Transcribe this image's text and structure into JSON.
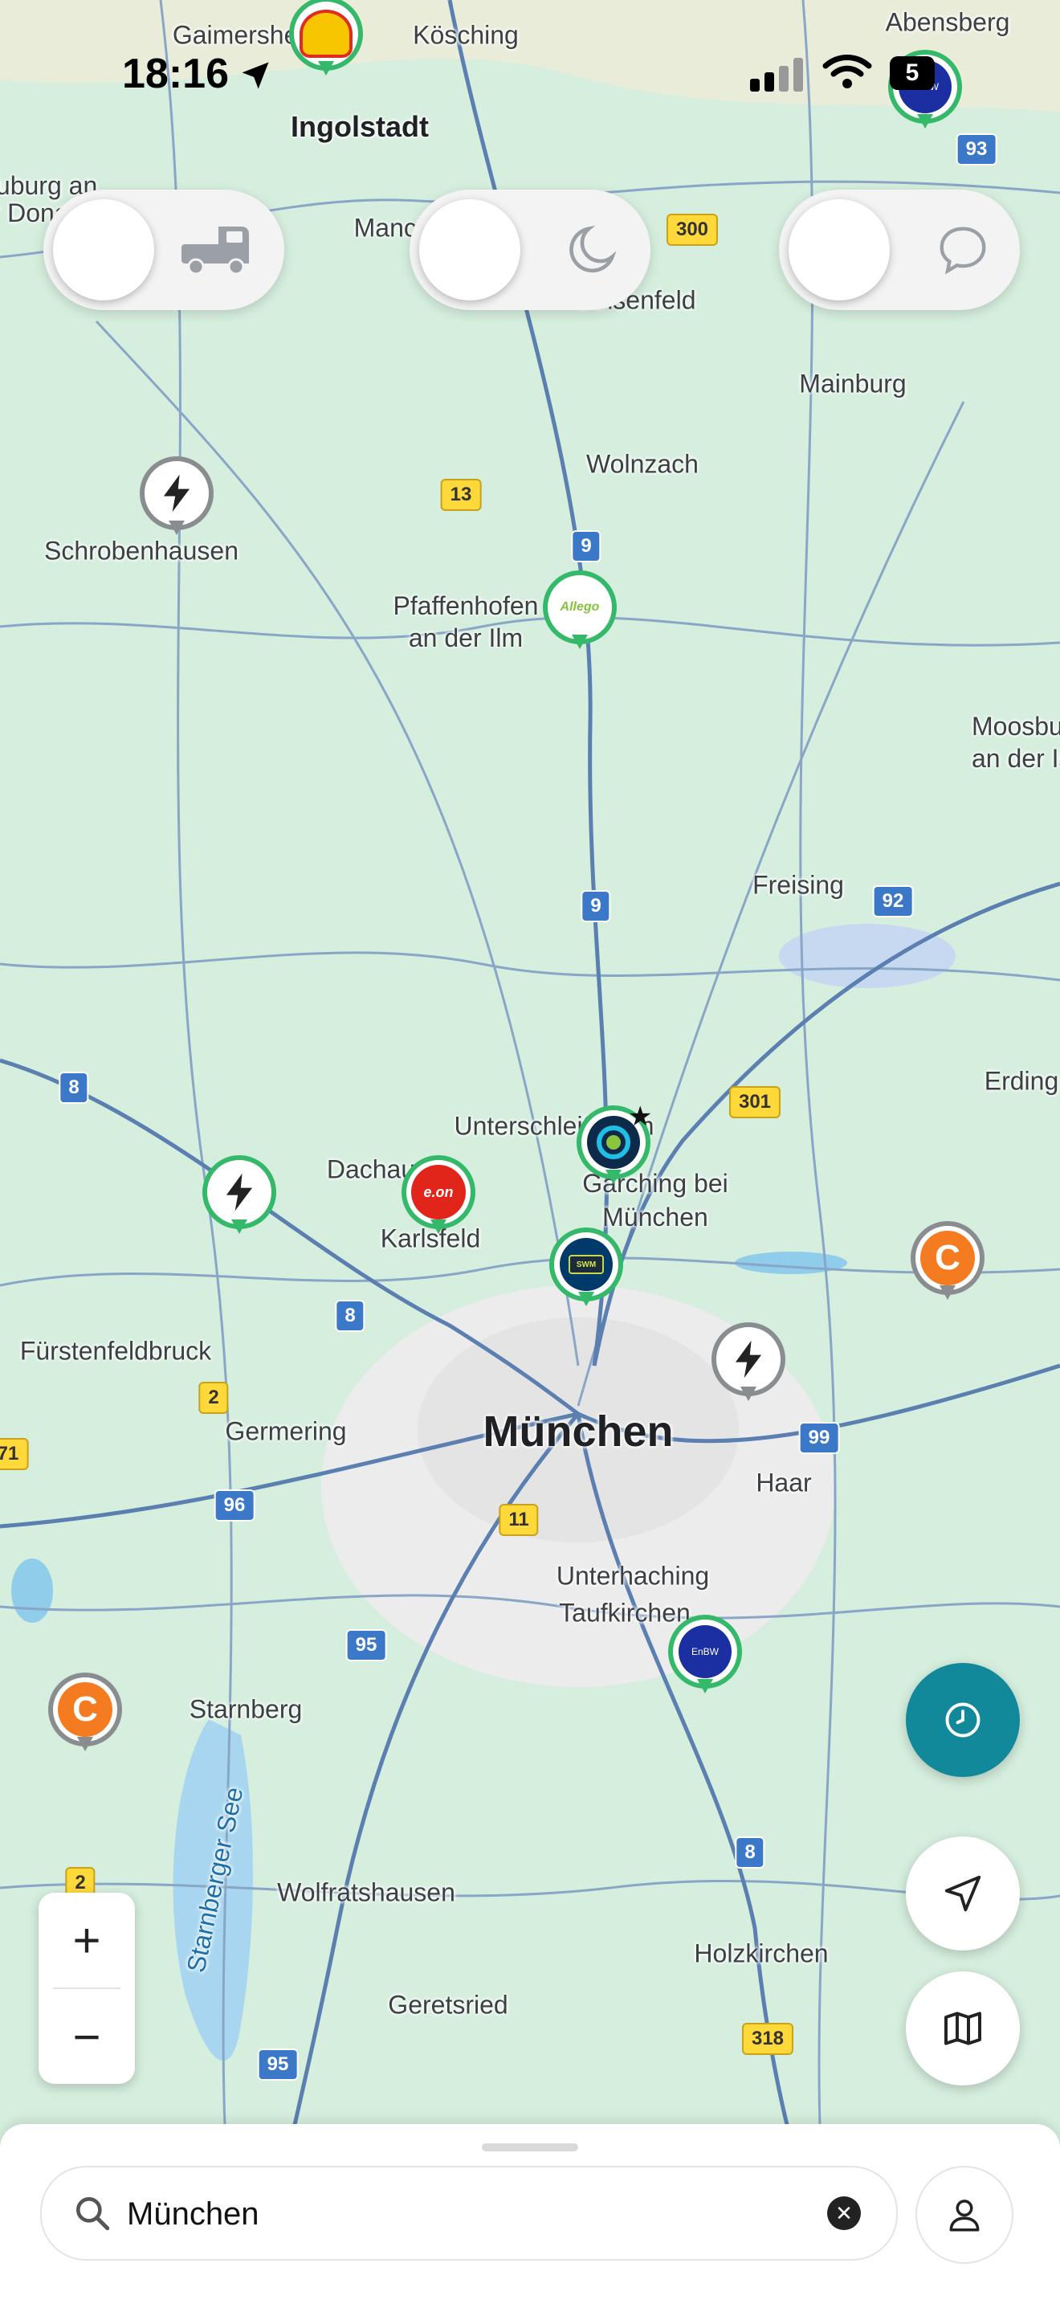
{
  "status_bar": {
    "time": "18:16",
    "battery": "5"
  },
  "places": [
    "Gaimersheim",
    "Kösching",
    "Abensberg",
    "Ingolstadt",
    "Neuburg an der Donau",
    "Manching",
    "Geisenfeld",
    "Mainburg",
    "Wolnzach",
    "Schrobenhausen",
    "Pfaffenhofen an der Ilm",
    "Moosburg an der Isar",
    "Freising",
    "Erding",
    "Unterschleißheim",
    "Dachau",
    "Garching bei München",
    "Karlsfeld",
    "Fürstenfeldbruck",
    "Germering",
    "München",
    "Haar",
    "Unterhaching",
    "Taufkirchen",
    "Starnberg",
    "Starnberger See",
    "Wolfratshausen",
    "Holzkirchen",
    "Geretsried"
  ],
  "road_shields": [
    "93",
    "300",
    "13",
    "9",
    "9",
    "92",
    "8",
    "301",
    "8",
    "2",
    "99",
    "96",
    "11",
    "95",
    "8",
    "318",
    "95",
    "2",
    "71"
  ],
  "pins": [
    {
      "brand": "shell",
      "label": ""
    },
    {
      "brand": "enbw",
      "label": "EnBW"
    },
    {
      "brand": "generic",
      "label": ""
    },
    {
      "brand": "allego",
      "label": "Allego"
    },
    {
      "brand": "ionity",
      "label": ""
    },
    {
      "brand": "generic",
      "label": ""
    },
    {
      "brand": "eon",
      "label": "e.on"
    },
    {
      "brand": "swm",
      "label": "SWM"
    },
    {
      "brand": "c",
      "label": "C"
    },
    {
      "brand": "generic",
      "label": ""
    },
    {
      "brand": "enbw",
      "label": "EnBW"
    },
    {
      "brand": "c",
      "label": "C"
    }
  ],
  "toggles": [
    {
      "name": "truck",
      "icon": "truck-icon"
    },
    {
      "name": "night",
      "icon": "moon-icon"
    },
    {
      "name": "chat",
      "icon": "speech-bubble-icon"
    }
  ],
  "controls": {
    "zoom_in": "+",
    "zoom_out": "−"
  },
  "search": {
    "value": "München",
    "placeholder": ""
  },
  "colors": {
    "accent": "#11899a",
    "pin_green": "#34b86a",
    "pin_gray": "#8a8d90"
  }
}
